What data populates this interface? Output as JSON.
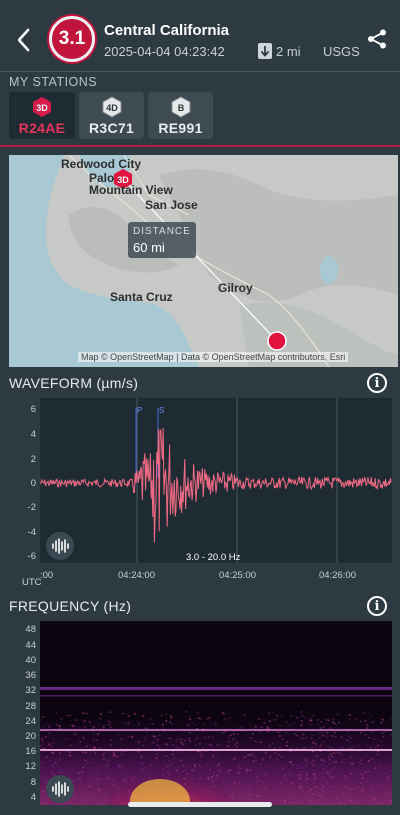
{
  "header": {
    "magnitude": "3.1",
    "region": "Central California",
    "datetime": "2025-04-04 04:23:42",
    "depth": "2 mi",
    "source": "USGS",
    "back_icon": "chevron-left-icon",
    "share_icon": "share-icon",
    "depth_icon": "arrow-down-icon"
  },
  "stations": {
    "label": "MY STATIONS",
    "items": [
      {
        "badge": "3D",
        "code": "R24AE",
        "active": true
      },
      {
        "badge": "4D",
        "code": "R3C71",
        "active": false
      },
      {
        "badge": "B",
        "code": "RE991",
        "active": false
      }
    ]
  },
  "map": {
    "places": [
      "Redwood City",
      "Palo",
      "Mountain View",
      "San Jose",
      "Santa Cruz",
      "Gilroy"
    ],
    "station_marker": "3D",
    "distance_label": "DISTANCE",
    "distance_value": "60 mi",
    "attribution": "Map © OpenStreetMap | Data © OpenStreetMap contributors, Esri"
  },
  "waveform": {
    "title": "WAVEFORM (µm/s)",
    "y_ticks": [
      "6",
      "4",
      "2",
      "0",
      "-2",
      "-4",
      "-6"
    ],
    "x_ticks": [
      ":00",
      "04:24:00",
      "04:25:00",
      "04:26:00"
    ],
    "utc_label": "UTC",
    "band": "3.0 - 20.0 Hz",
    "p_label": "P",
    "s_label": "S"
  },
  "frequency": {
    "title": "FREQUENCY (Hz)",
    "y_ticks": [
      "48",
      "44",
      "40",
      "36",
      "32",
      "28",
      "24",
      "20",
      "16",
      "12",
      "8",
      "4"
    ]
  },
  "colors": {
    "accent": "#c0143c",
    "waveform": "#f06a85",
    "background": "#2d3a42",
    "plot_bg": "#1f2b32"
  }
}
